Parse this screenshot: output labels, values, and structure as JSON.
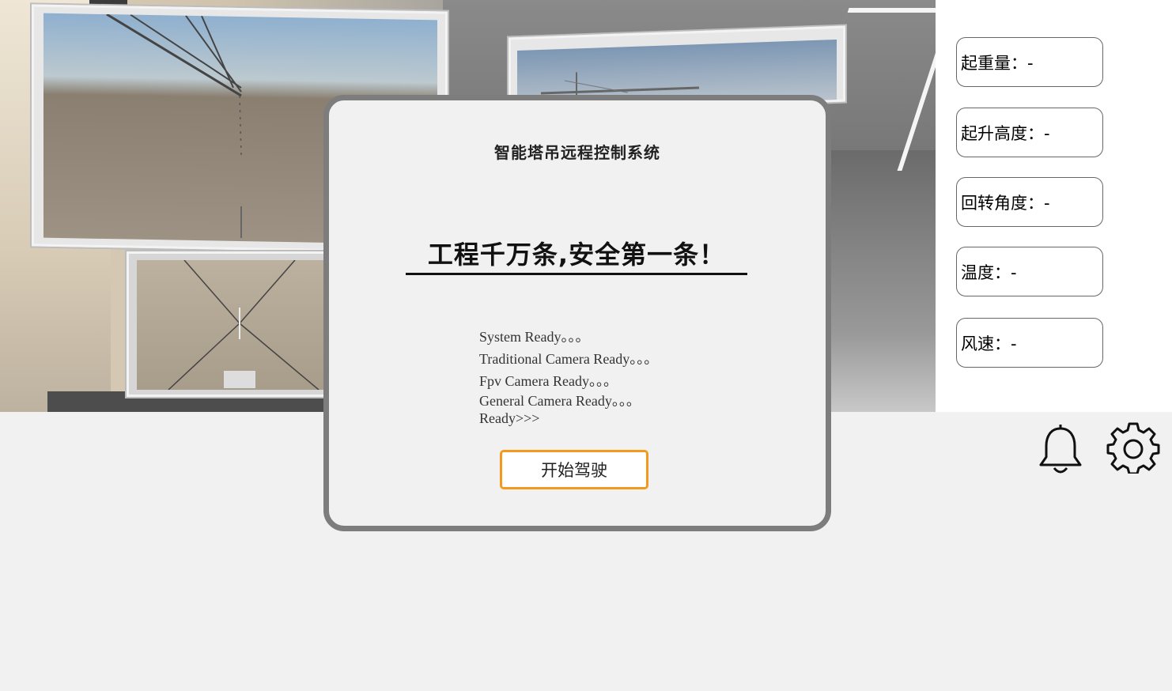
{
  "dialog": {
    "system_title": "智能塔吊远程控制系统",
    "slogan": "工程千万条,安全第一条！",
    "status_lines": [
      "System Ready。。。",
      "Traditional Camera Ready。。。",
      "Fpv Camera Ready。。。",
      "General Camera Ready。。。",
      "Ready>>>"
    ],
    "start_button": "开始驾驶",
    "button_border_color": "#f39a1d"
  },
  "info_panel": {
    "lifting_weight": "起重量：-",
    "lifting_height": "起升高度：-",
    "slewing_angle": "回转角度：-",
    "temperature": "温度：-",
    "wind_speed": "风速：-"
  },
  "icons": {
    "notification": "bell-icon",
    "settings": "gear-icon"
  }
}
